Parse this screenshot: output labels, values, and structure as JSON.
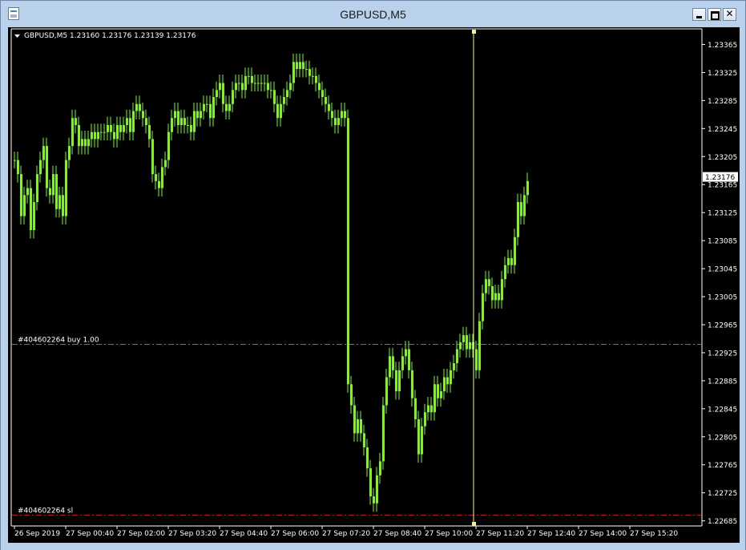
{
  "window": {
    "title": "GBPUSD,M5"
  },
  "header": {
    "text": "GBPUSD,M5  1.23160 1.23176 1.23139 1.23176"
  },
  "colors": {
    "background": "#000000",
    "candle": "#7CFC00",
    "buy_line": "#2ea043",
    "sl_line": "#cc1f1f",
    "crosshair": "#f5f08c",
    "axis_text": "#ffffff"
  },
  "orders": [
    {
      "label": "#404602264 buy 1.00",
      "price": 1.22937,
      "color": "#2ea043"
    },
    {
      "label": "#404602264 sl",
      "price": 1.22693,
      "color": "#cc1f1f"
    }
  ],
  "price_labels": [
    "1.23365",
    "1.23325",
    "1.23285",
    "1.23245",
    "1.23205",
    "1.23165",
    "1.23125",
    "1.23085",
    "1.23045",
    "1.23005",
    "1.22965",
    "1.22925",
    "1.22885",
    "1.22845",
    "1.22805",
    "1.22765",
    "1.22725",
    "1.22685"
  ],
  "current_price": "1.23176",
  "time_labels": [
    "26 Sep 2019",
    "27 Sep 00:40",
    "27 Sep 02:00",
    "27 Sep 03:20",
    "27 Sep 04:40",
    "27 Sep 06:00",
    "27 Sep 07:20",
    "27 Sep 08:40",
    "27 Sep 10:00",
    "27 Sep 11:20",
    "27 Sep 12:40",
    "27 Sep 14:00",
    "27 Sep 15:20"
  ],
  "chart_data": {
    "type": "line",
    "symbol": "GBPUSD",
    "timeframe": "M5",
    "ylim": [
      1.2268,
      1.23385
    ],
    "current_price": 1.23176,
    "bars_per_label": 16,
    "series": [
      {
        "values": [
          1.232,
          1.2318,
          1.2312,
          1.2315,
          1.2316,
          1.231,
          1.2314,
          1.2318,
          1.232,
          1.2322,
          1.2316,
          1.2315,
          1.2318,
          1.2313,
          1.2315,
          1.2312,
          1.232,
          1.2322,
          1.2326,
          1.2325,
          1.2322,
          1.2323,
          1.2322,
          1.2323,
          1.2324,
          1.2323,
          1.2324,
          1.2324,
          1.2324,
          1.2325,
          1.2324,
          1.2323,
          1.2325,
          1.2324,
          1.2325,
          1.2326,
          1.2324,
          1.2327,
          1.2328,
          1.2327,
          1.2326,
          1.2325,
          1.2323,
          1.2318,
          1.2317,
          1.2316,
          1.2319,
          1.232,
          1.2324,
          1.2326,
          1.2327,
          1.2325,
          1.2326,
          1.2325,
          1.2325,
          1.2324,
          1.2327,
          1.2326,
          1.2327,
          1.2328,
          1.2328,
          1.2326,
          1.2329,
          1.233,
          1.2331,
          1.2328,
          1.2327,
          1.2328,
          1.233,
          1.2331,
          1.2331,
          1.233,
          1.2332,
          1.2332,
          1.2331,
          1.2331,
          1.2331,
          1.2331,
          1.2331,
          1.233,
          1.233,
          1.2328,
          1.2326,
          1.2328,
          1.2329,
          1.233,
          1.2331,
          1.2334,
          1.2333,
          1.2334,
          1.2333,
          1.2333,
          1.2332,
          1.2332,
          1.2331,
          1.233,
          1.2329,
          1.2328,
          1.2327,
          1.2326,
          1.2325,
          1.2326,
          1.2327,
          1.2326,
          1.2288,
          1.2285,
          1.2281,
          1.2283,
          1.2281,
          1.2279,
          1.2276,
          1.2272,
          1.2271,
          1.2275,
          1.2277,
          1.2285,
          1.2289,
          1.2292,
          1.229,
          1.2287,
          1.229,
          1.2292,
          1.2293,
          1.229,
          1.2286,
          1.2283,
          1.2278,
          1.2282,
          1.2284,
          1.2285,
          1.2284,
          1.2288,
          1.2286,
          1.2287,
          1.2289,
          1.2288,
          1.229,
          1.2291,
          1.2293,
          1.2294,
          1.2295,
          1.2293,
          1.2294,
          1.2293,
          1.229,
          1.2297,
          1.2301,
          1.2303,
          1.2302,
          1.23,
          1.2301,
          1.23,
          1.2303,
          1.2305,
          1.2306,
          1.2305,
          1.2309,
          1.2314,
          1.2312,
          1.2315,
          1.2317
        ]
      }
    ]
  }
}
